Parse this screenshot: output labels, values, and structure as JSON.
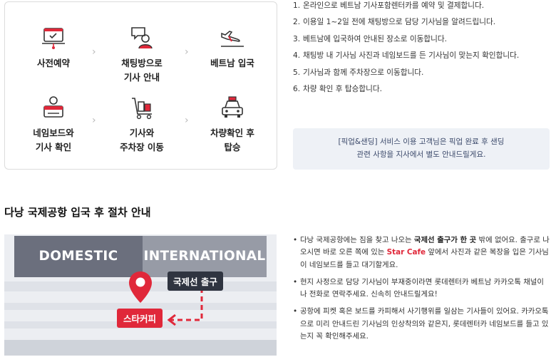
{
  "steps": [
    {
      "label": "사전예약",
      "icon": "laptop-booking-icon"
    },
    {
      "label": "채팅방으로\n기사 안내",
      "icon": "chat-person-icon"
    },
    {
      "label": "베트남 입국",
      "icon": "airplane-landing-icon"
    },
    {
      "label": "네임보드와\n기사 확인",
      "icon": "driver-nameboard-icon"
    },
    {
      "label": "기사와\n주차장 이동",
      "icon": "luggage-cart-icon"
    },
    {
      "label": "차량확인 후\n탑승",
      "icon": "car-front-icon"
    }
  ],
  "instructions": [
    {
      "num": "1.",
      "text": "온라인으로 베트남 기사포함렌터카를 예약 및 결제합니다."
    },
    {
      "num": "2.",
      "text": "이용일 1~2일 전에 채팅방으로 담당 기사님을 알려드립니다."
    },
    {
      "num": "3.",
      "text": "베트남에 입국하여 안내된 장소로 이동합니다."
    },
    {
      "num": "4.",
      "text": "채팅방 내 기사님 사진과 네임보드를 든 기사님이 맞는지 확인합니다."
    },
    {
      "num": "5.",
      "text": "기사님과 함께 주차장으로 이동합니다."
    },
    {
      "num": "6.",
      "text": "차량 확인 후 탑승합니다."
    }
  ],
  "pickup_note": {
    "line1": "[픽업&샌딩] 서비스 이용 고객님은 픽업 완료 후 샌딩",
    "line2": "관련 사항을 지사에서 별도 안내드릴게요."
  },
  "section_title": "다낭 국제공항 입국 후 절차 안내",
  "map": {
    "domestic": "DOMESTIC",
    "international": "INTERNATIONAL",
    "exit_label": "국제선 출구",
    "meeting_label": "스타커피"
  },
  "bullets": {
    "b1_a": "다낭 국제공항에는 짐을 찾고 나오는 ",
    "b1_b": "국제선 출구가 한 곳",
    "b1_c": " 밖에 없어요. 출구로 나오시면 바로 오른 쪽에 있는 ",
    "b1_d": "Star Cafe",
    "b1_e": " 앞에서 사진과 같은 복장을 입은 기사님이 네임보드를 들고 대기할게요.",
    "b2": "현지 사정으로 담당 기사님이 부재중이라면 롯데렌터카 베트남 카카오톡 채널이나 전화로 연락주세요. 신속히 안내드릴게요!",
    "b3": "공항에 피켓 혹은 보드를 카피해서 사기행위를 일삼는 기사들이 있어요. 카카오톡으로 미리 안내드린 기사님의 인상착의와 같은지, 롯데렌터카 네임보드를 들고 있는지 꼭 확인해주세요."
  },
  "colors": {
    "accent_red": "#e0283a",
    "dark": "#2f3440",
    "note_bg": "#eef1f6"
  }
}
